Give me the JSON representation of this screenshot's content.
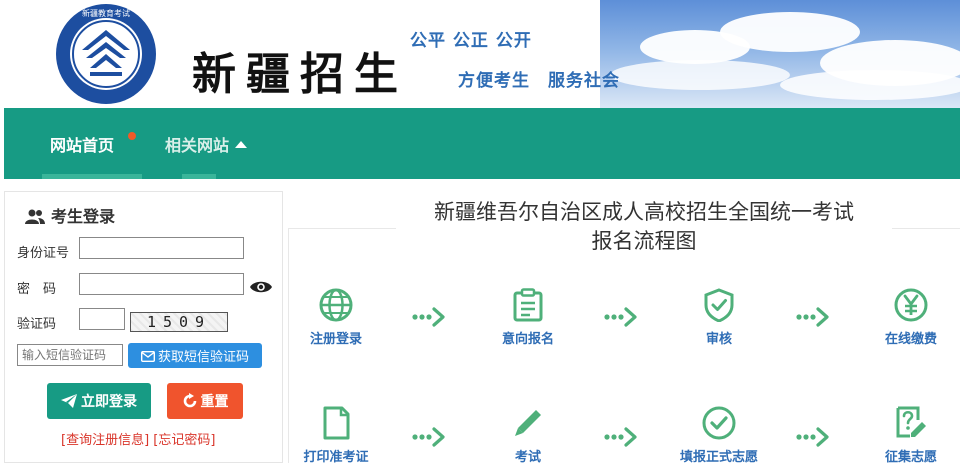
{
  "header": {
    "brand": "新疆招生",
    "slogan_line1": "公平 公正 公开",
    "slogan_line2": "方便考生　服务社会",
    "logo_text": "新疆教育考试"
  },
  "nav": {
    "items": [
      {
        "label": "网站首页",
        "active": true,
        "has_dot": true
      },
      {
        "label": "相关网站",
        "has_caret": true
      }
    ],
    "color": "#179b84"
  },
  "login": {
    "title": "考生登录",
    "id_label": "身份证号",
    "id_value": "",
    "password_label": "密　码",
    "password_value": "",
    "captcha_label": "验证码",
    "captcha_value": "",
    "captcha_image_text": "1509",
    "sms_placeholder": "输入短信验证码",
    "sms_button": "获取短信验证码",
    "login_button": "立即登录",
    "reset_button": "重置",
    "link_query": "[查询注册信息]",
    "link_forgot": "[忘记密码]"
  },
  "flow": {
    "title_line1": "新疆维吾尔自治区成人高校招生全国统一考试",
    "title_line2": "报名流程图",
    "steps": [
      {
        "label": "注册登录",
        "icon": "globe-icon"
      },
      {
        "label": "意向报名",
        "icon": "clipboard-icon"
      },
      {
        "label": "审核",
        "icon": "shield-check-icon"
      },
      {
        "label": "在线缴费",
        "icon": "yuan-icon"
      },
      {
        "label": "打印准考证",
        "icon": "document-icon"
      },
      {
        "label": "考试",
        "icon": "pencil-icon"
      },
      {
        "label": "填报正式志愿",
        "icon": "check-circle-icon"
      },
      {
        "label": "征集志愿",
        "icon": "question-edit-icon"
      }
    ],
    "icon_color": "#4fb07a",
    "label_color": "#2f6db5"
  },
  "colors": {
    "accent_green": "#179b84",
    "reset_orange": "#f0542d",
    "sms_blue": "#2d8fe0",
    "link_red": "#d9352a"
  }
}
